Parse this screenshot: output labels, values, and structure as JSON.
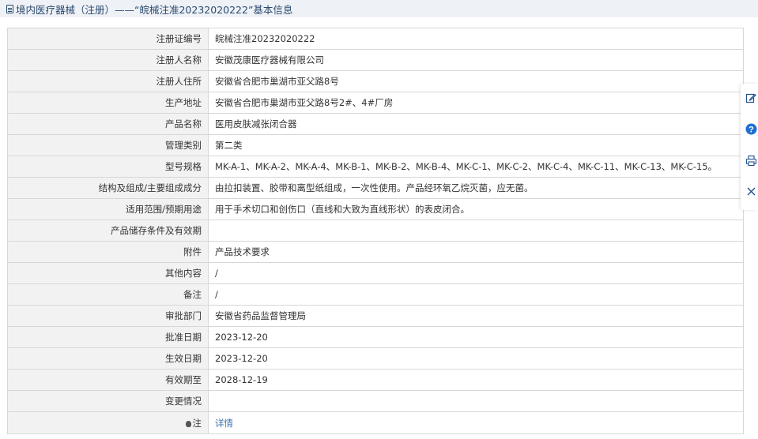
{
  "header": {
    "title": "境内医疗器械（注册）——“皖械注准20232020222”基本信息"
  },
  "rows": [
    {
      "label": "注册证编号",
      "value": "皖械注准20232020222"
    },
    {
      "label": "注册人名称",
      "value": "安徽茂康医疗器械有限公司"
    },
    {
      "label": "注册人住所",
      "value": "安徽省合肥市巢湖市亚父路8号"
    },
    {
      "label": "生产地址",
      "value": "安徽省合肥市巢湖市亚父路8号2#、4#厂房"
    },
    {
      "label": "产品名称",
      "value": "医用皮肤减张闭合器"
    },
    {
      "label": "管理类别",
      "value": "第二类"
    },
    {
      "label": "型号规格",
      "value": "MK-A-1、MK-A-2、MK-A-4、MK-B-1、MK-B-2、MK-B-4、MK-C-1、MK-C-2、MK-C-4、MK-C-11、MK-C-13、MK-C-15。"
    },
    {
      "label": "结构及组成/主要组成成分",
      "value": "由拉扣装置、胶带和离型纸组成，一次性使用。产品经环氧乙烷灭菌，应无菌。"
    },
    {
      "label": "适用范围/预期用途",
      "value": "用于手术切口和创伤口（直线和大致为直线形状）的表皮闭合。"
    },
    {
      "label": "产品储存条件及有效期",
      "value": ""
    },
    {
      "label": "附件",
      "value": "产品技术要求"
    },
    {
      "label": "其他内容",
      "value": "/"
    },
    {
      "label": "备注",
      "value": "/"
    },
    {
      "label": "审批部门",
      "value": "安徽省药品监督管理局"
    },
    {
      "label": "批准日期",
      "value": "2023-12-20"
    },
    {
      "label": "生效日期",
      "value": "2023-12-20"
    },
    {
      "label": "有效期至",
      "value": "2028-12-19"
    },
    {
      "label": "变更情况",
      "value": ""
    }
  ],
  "note": {
    "label": "注",
    "link_text": "详情"
  },
  "toolbar": {
    "icons": [
      "edit-icon",
      "help-icon",
      "print-icon",
      "close-icon"
    ]
  },
  "colors": {
    "header_bg": "#eef1f6",
    "header_text": "#2b4a6e",
    "label_bg": "#f2f2f2",
    "border": "#d7d7d7",
    "link": "#3a6fb0",
    "help_blue": "#1f6fd1"
  }
}
